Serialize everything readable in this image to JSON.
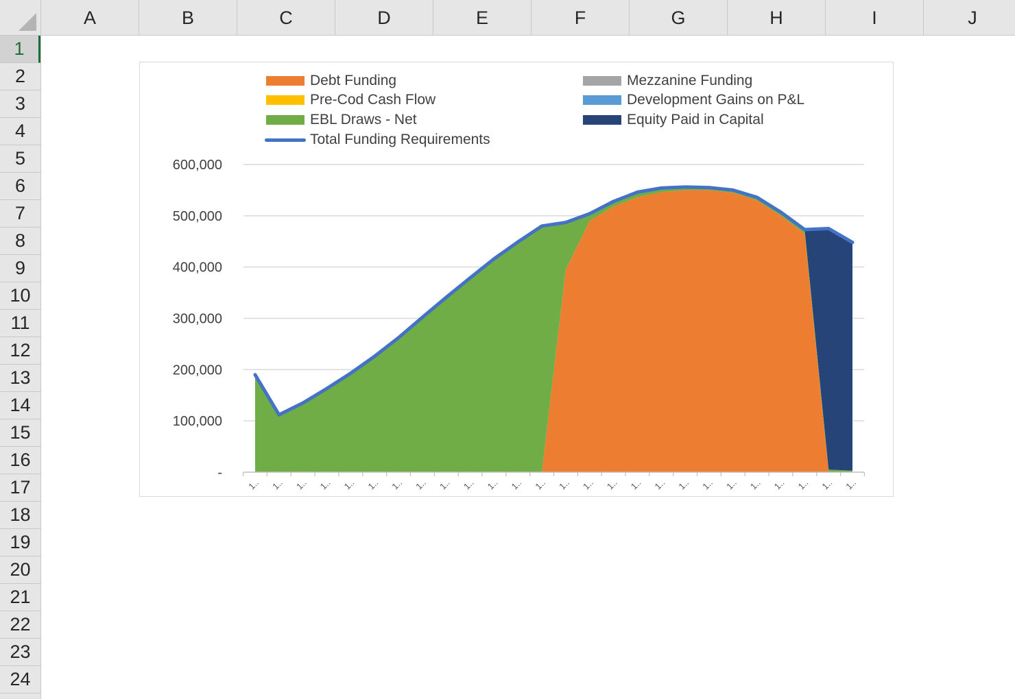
{
  "sheet": {
    "columns": [
      "A",
      "B",
      "C",
      "D",
      "E",
      "F",
      "G",
      "H",
      "I",
      "J"
    ],
    "rows": [
      "1",
      "2",
      "3",
      "4",
      "5",
      "6",
      "7",
      "8",
      "9",
      "10",
      "11",
      "12",
      "13",
      "14",
      "15",
      "16",
      "17",
      "18",
      "19",
      "20",
      "21",
      "22",
      "23",
      "24"
    ],
    "active_row": "1"
  },
  "colors": {
    "debt": "#ed7d31",
    "mezzanine": "#a5a5a5",
    "precod": "#ffc000",
    "devgains": "#5b9bd5",
    "ebl": "#70ad47",
    "equity": "#264478",
    "total": "#4472c4",
    "grid": "#d9d9d9"
  },
  "chart_data": {
    "type": "area",
    "stacked": true,
    "ylim": [
      0,
      600000
    ],
    "yticks": [
      "-",
      "100,000",
      "200,000",
      "300,000",
      "400,000",
      "500,000",
      "600,000"
    ],
    "ytick_values": [
      0,
      100000,
      200000,
      300000,
      400000,
      500000,
      600000
    ],
    "x_tick_label": "1..",
    "categories": 26,
    "legend": [
      {
        "name": "Debt Funding",
        "color_key": "debt",
        "kind": "area"
      },
      {
        "name": "Mezzanine Funding",
        "color_key": "mezzanine",
        "kind": "area"
      },
      {
        "name": "Pre-Cod Cash Flow",
        "color_key": "precod",
        "kind": "area"
      },
      {
        "name": "Development Gains on P&L",
        "color_key": "devgains",
        "kind": "area"
      },
      {
        "name": "EBL Draws - Net",
        "color_key": "ebl",
        "kind": "area"
      },
      {
        "name": "Equity Paid in Capital",
        "color_key": "equity",
        "kind": "area"
      },
      {
        "name": "Total Funding Requirements",
        "color_key": "total",
        "kind": "line"
      }
    ],
    "legend_position": "top",
    "series": [
      {
        "name": "Debt Funding",
        "color_key": "debt",
        "values": [
          0,
          0,
          0,
          0,
          0,
          0,
          0,
          0,
          0,
          0,
          0,
          0,
          0,
          395000,
          490000,
          518000,
          536000,
          546000,
          550000,
          550000,
          545000,
          530000,
          500000,
          465000,
          0,
          0
        ]
      },
      {
        "name": "EBL Draws - Net",
        "color_key": "ebl",
        "values": [
          190000,
          112000,
          135000,
          163000,
          193000,
          226000,
          262000,
          302000,
          341000,
          379000,
          416000,
          449000,
          480000,
          92000,
          14000,
          10000,
          10000,
          8000,
          6000,
          5000,
          5000,
          6000,
          7000,
          8000,
          5000,
          3000
        ]
      },
      {
        "name": "Equity Paid in Capital",
        "color_key": "equity",
        "values": [
          0,
          0,
          0,
          0,
          0,
          0,
          0,
          0,
          0,
          0,
          0,
          0,
          0,
          0,
          0,
          0,
          0,
          0,
          0,
          0,
          0,
          0,
          0,
          0,
          470000,
          445000
        ]
      },
      {
        "name": "Total Funding Requirements",
        "color_key": "total",
        "kind": "line",
        "values": [
          190000,
          112000,
          135000,
          163000,
          193000,
          226000,
          262000,
          302000,
          341000,
          379000,
          416000,
          449000,
          480000,
          487000,
          504000,
          528000,
          546000,
          554000,
          556000,
          555000,
          550000,
          536000,
          507000,
          473000,
          475000,
          448000
        ]
      }
    ]
  }
}
